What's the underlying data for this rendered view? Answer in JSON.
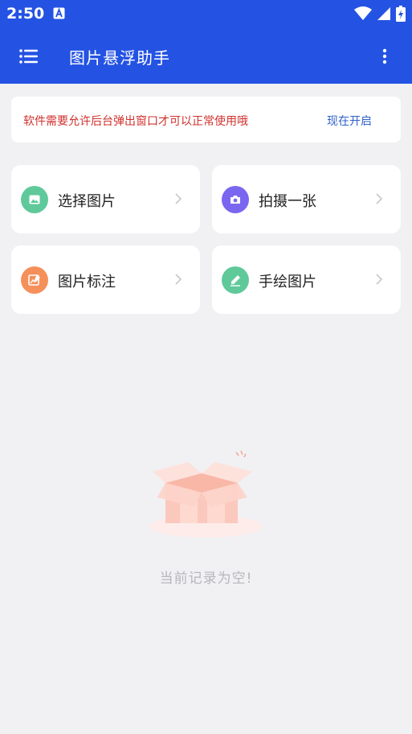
{
  "status_bar": {
    "time": "2:50",
    "notification_icon": "app-notification-icon",
    "icons": [
      "wifi-icon",
      "signal-icon",
      "battery-charging-icon"
    ]
  },
  "app_bar": {
    "title": "图片悬浮助手",
    "menu_icon": "hamburger-menu-icon",
    "more_icon": "more-vert-icon",
    "color": "#2453e3"
  },
  "banner": {
    "message": "软件需要允许后台弹出窗口才可以正常使用哦",
    "action": "现在开启",
    "message_color": "#d0312d",
    "action_color": "#2f5fc9"
  },
  "actions": [
    {
      "label": "选择图片",
      "icon": "image-icon",
      "color": "#5fc99a"
    },
    {
      "label": "拍摄一张",
      "icon": "camera-icon",
      "color": "#7a67f0"
    },
    {
      "label": "图片标注",
      "icon": "image-annotate-icon",
      "color": "#f5905a"
    },
    {
      "label": "手绘图片",
      "icon": "pen-icon",
      "color": "#5fc99a"
    }
  ],
  "empty_state": {
    "illustration": "empty-box-illustration",
    "text": "当前记录为空!"
  }
}
